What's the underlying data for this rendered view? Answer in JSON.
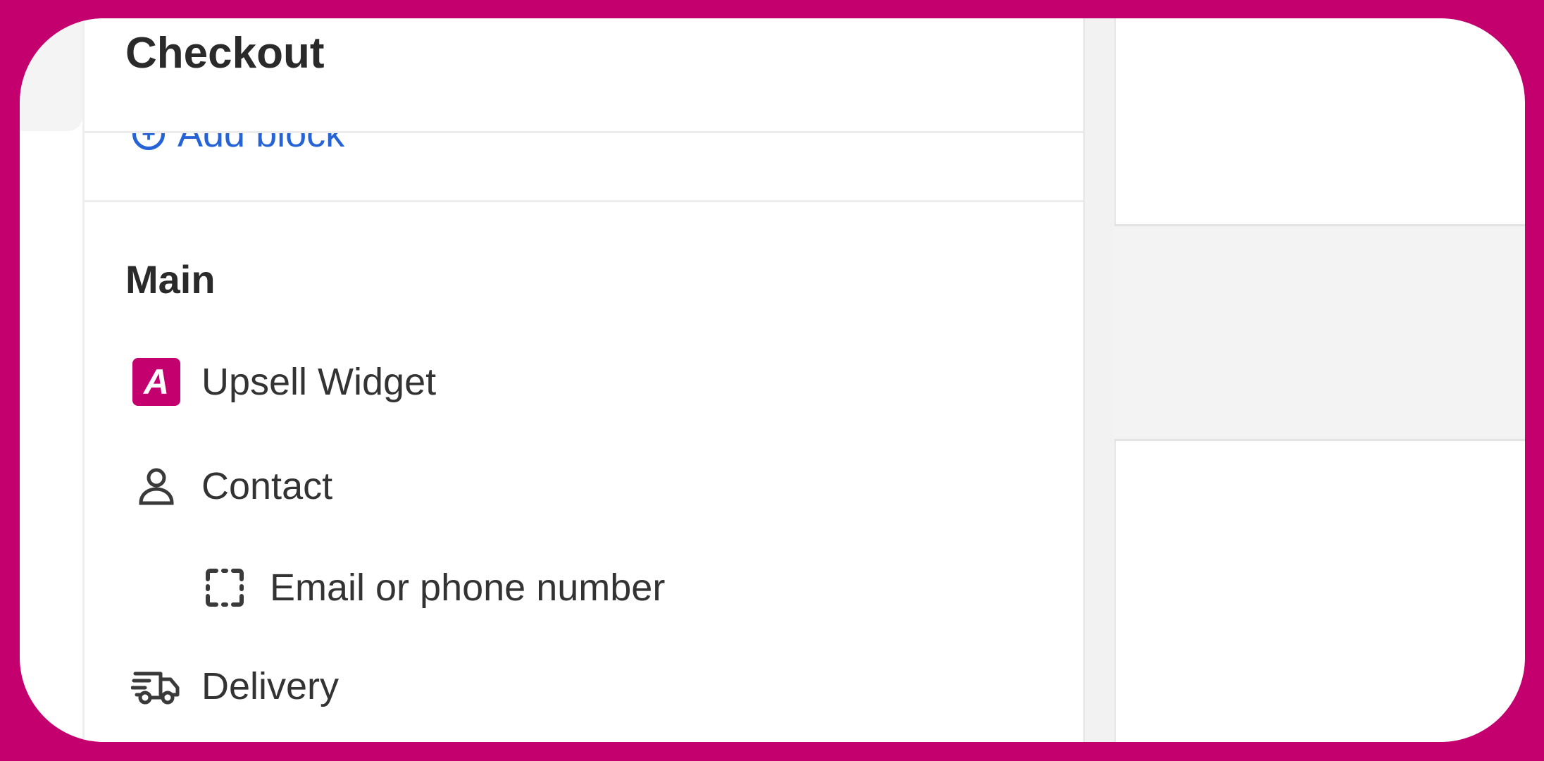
{
  "brand": {
    "frame_color": "#c4006f",
    "link_color": "#2563d6"
  },
  "header": {
    "title": "Checkout"
  },
  "add_block": {
    "label": "Add block",
    "icon": "add-circle-icon"
  },
  "main": {
    "title": "Main",
    "items": [
      {
        "label": "Upsell Widget",
        "icon": "upsell-widget-logo-icon",
        "icon_text": "A"
      },
      {
        "label": "Contact",
        "icon": "person-icon"
      },
      {
        "label": "Email or phone number",
        "icon": "field-placeholder-icon",
        "indent": true
      },
      {
        "label": "Delivery",
        "icon": "truck-icon"
      }
    ]
  }
}
